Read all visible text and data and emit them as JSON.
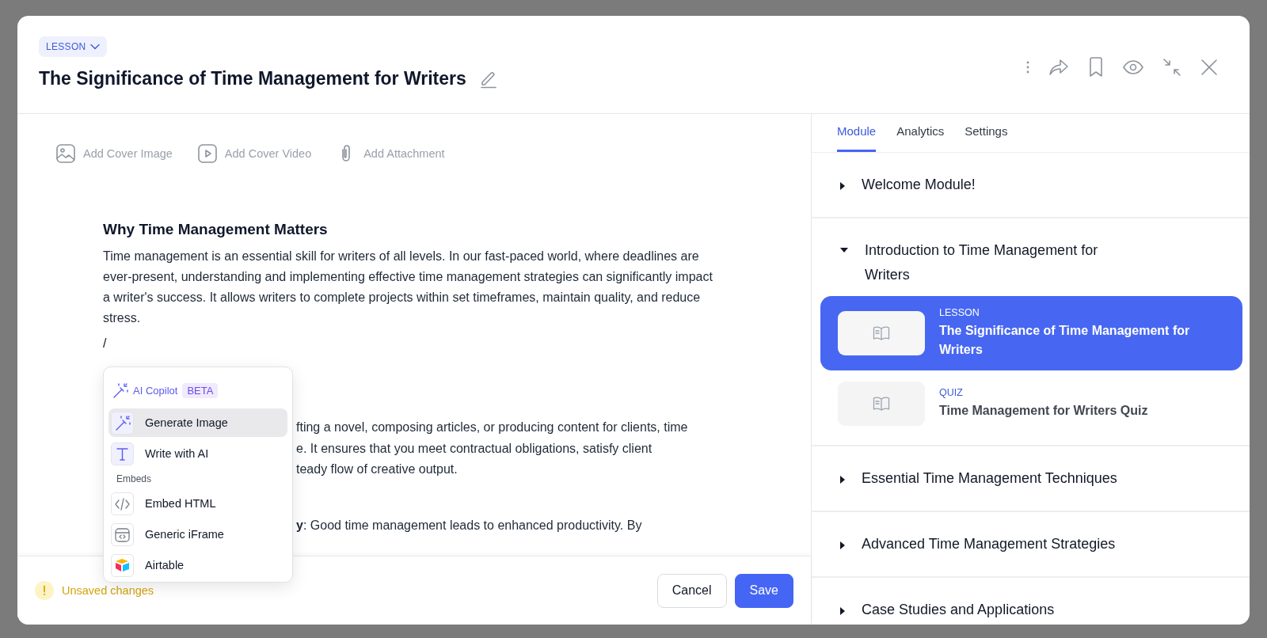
{
  "lesson_type": {
    "label": "LESSON"
  },
  "title": "The Significance of Time Management for Writers",
  "cover_actions": [
    {
      "label": "Add Cover Image",
      "kind": "image"
    },
    {
      "label": "Add Cover Video",
      "kind": "video"
    },
    {
      "label": "Add Attachment",
      "kind": "attachment"
    }
  ],
  "editor": {
    "heading": "Why Time Management Matters",
    "paragraph": "Time management is an essential skill for writers of all levels. In our fast-paced world, where deadlines are ever-present, understanding and implementing effective time management strategies can significantly impact a writer's success. It allows writers to complete projects within set timeframes, maintain quality, and reduce stress.",
    "slash": "/",
    "partial_lines": [
      "fting a novel, composing articles, or producing content for clients, time",
      "e. It ensures that you meet contractual obligations, satisfy client",
      "teady flow of creative output."
    ],
    "partial_list_line": "**y**: Good time management leads to enhanced productivity. By"
  },
  "insert_menu": {
    "section": "AI Copilot",
    "badge": "BETA",
    "items": [
      {
        "label": "Generate Image",
        "kind": "wand",
        "selected": true
      },
      {
        "label": "Write with AI",
        "kind": "text",
        "selected": false
      }
    ],
    "embeds_label": "Embeds",
    "embeds": [
      {
        "label": "Embed HTML",
        "kind": "code",
        "selected": false
      },
      {
        "label": "Generic iFrame",
        "kind": "iframe",
        "selected": false
      },
      {
        "label": "Airtable",
        "kind": "airtable",
        "selected": false
      }
    ]
  },
  "footer": {
    "status": "Unsaved changes",
    "buttons": [
      {
        "label": "Cancel",
        "kind": "secondary"
      },
      {
        "label": "Save",
        "kind": "primary"
      }
    ]
  },
  "sidebar": {
    "tabs": [
      {
        "label": "Module",
        "selected": true
      },
      {
        "label": "Analytics",
        "selected": false
      },
      {
        "label": "Settings",
        "selected": false
      }
    ],
    "modules": [
      {
        "title": "Welcome Module!",
        "expanded": false
      },
      {
        "title": "Introduction to Time Management for Writers",
        "expanded": true,
        "children": [
          {
            "type": "LESSON",
            "title": "The Significance of Time Management for Writers",
            "selected": true
          },
          {
            "type": "QUIZ",
            "title": "Time Management for Writers Quiz",
            "selected": false
          }
        ]
      },
      {
        "title": "Essential Time Management Techniques",
        "expanded": false
      },
      {
        "title": "Advanced Time Management Strategies",
        "expanded": false
      },
      {
        "title": "Case Studies and Applications",
        "expanded": false
      }
    ]
  }
}
